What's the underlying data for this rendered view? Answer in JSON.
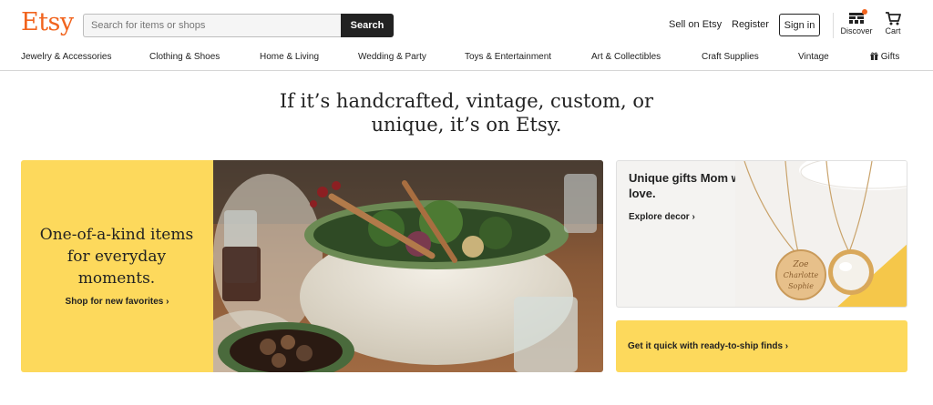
{
  "header": {
    "logo": "Etsy",
    "search_placeholder": "Search for items or shops",
    "search_button": "Search",
    "sell_link": "Sell on Etsy",
    "register_link": "Register",
    "signin_button": "Sign in",
    "discover_label": "Discover",
    "cart_label": "Cart"
  },
  "categories": [
    "Jewelry & Accessories",
    "Clothing & Shoes",
    "Home & Living",
    "Wedding & Party",
    "Toys & Entertainment",
    "Art & Collectibles",
    "Craft Supplies",
    "Vintage",
    "Gifts"
  ],
  "headline": {
    "line1": "If it’s handcrafted, vintage, custom, or",
    "line2": "unique, it’s on Etsy."
  },
  "hero": {
    "title": "One-of-a-kind items for everyday moments.",
    "cta": "Shop for new favorites ›"
  },
  "gifts_card": {
    "title": "Unique gifts Mom will love.",
    "cta": "Explore decor ›",
    "engraving": [
      "Zoe",
      "Charlotte",
      "Sophie"
    ]
  },
  "ship_card": {
    "cta": "Get it quick with ready-to-ship finds ›"
  },
  "colors": {
    "brand": "#F1641E",
    "accent_yellow": "#FDD95C",
    "button_dark": "#222222"
  },
  "icons": [
    "discover-icon",
    "cart-icon",
    "gift-icon",
    "chevron-right-icon"
  ]
}
